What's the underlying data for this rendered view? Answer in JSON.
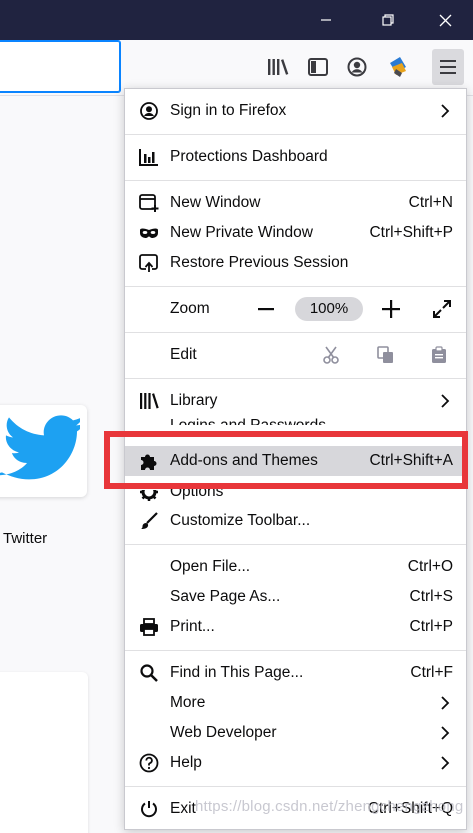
{
  "window_controls": {
    "minimize_icon": "minimize-icon",
    "restore_icon": "restore-icon",
    "close_icon": "close-icon"
  },
  "toolbar": {
    "icons": [
      "library-icon",
      "sidebar-icon",
      "account-icon",
      "extension-icon",
      "hamburger-menu-icon"
    ]
  },
  "content": {
    "topsite_label": "Twitter"
  },
  "menu": {
    "sign_in": "Sign in to Firefox",
    "protections": "Protections Dashboard",
    "new_window": "New Window",
    "new_window_sc": "Ctrl+N",
    "new_private": "New Private Window",
    "new_private_sc": "Ctrl+Shift+P",
    "restore": "Restore Previous Session",
    "zoom": "Zoom",
    "zoom_minus": "−",
    "zoom_value": "100%",
    "zoom_plus": "+",
    "edit": "Edit",
    "library": "Library",
    "logins": "Logins and Passwords",
    "addons": "Add-ons and Themes",
    "addons_sc": "Ctrl+Shift+A",
    "options": "Options",
    "customize": "Customize Toolbar...",
    "open_file": "Open File...",
    "open_file_sc": "Ctrl+O",
    "save_page": "Save Page As...",
    "save_page_sc": "Ctrl+S",
    "print": "Print...",
    "print_sc": "Ctrl+P",
    "find": "Find in This Page...",
    "find_sc": "Ctrl+F",
    "more": "More",
    "web_dev": "Web Developer",
    "help": "Help",
    "exit": "Exit",
    "exit_sc": "Ctrl+Shift+Q"
  },
  "watermark": "https://blog.csdn.net/zhengchengzhong",
  "colors": {
    "titlebar": "#202340",
    "highlight": "#d7d7db",
    "annotation_red": "#e8363a",
    "twitter_blue": "#1da1f2"
  }
}
